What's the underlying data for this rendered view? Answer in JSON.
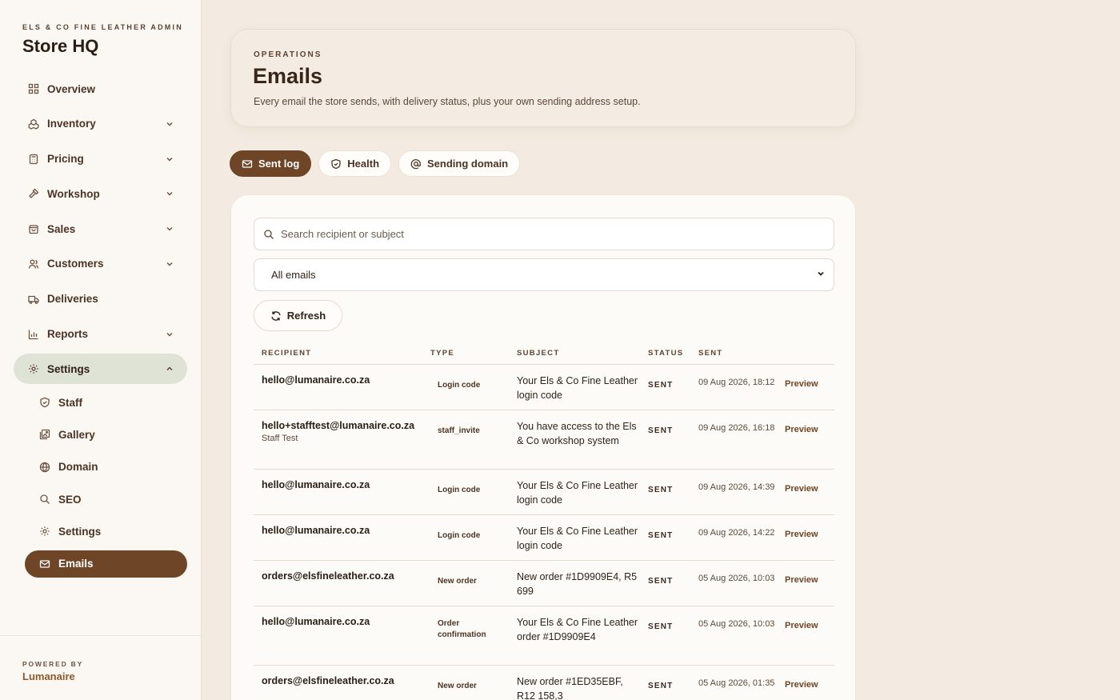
{
  "brand": {
    "eyebrow": "ELS & CO FINE LEATHER ADMIN",
    "title": "Store HQ"
  },
  "nav": {
    "items": [
      {
        "label": "Overview",
        "icon": "grid-icon"
      },
      {
        "label": "Inventory",
        "icon": "boxes-icon"
      },
      {
        "label": "Pricing",
        "icon": "calculator-icon"
      },
      {
        "label": "Workshop",
        "icon": "hammer-icon"
      },
      {
        "label": "Sales",
        "icon": "bag-icon"
      },
      {
        "label": "Customers",
        "icon": "users-icon"
      },
      {
        "label": "Deliveries",
        "icon": "truck-icon"
      },
      {
        "label": "Reports",
        "icon": "bar-chart-icon"
      },
      {
        "label": "Settings",
        "icon": "gear-icon"
      }
    ],
    "settings_sub": [
      {
        "label": "Staff",
        "icon": "shield-icon"
      },
      {
        "label": "Gallery",
        "icon": "images-icon"
      },
      {
        "label": "Domain",
        "icon": "globe-icon"
      },
      {
        "label": "SEO",
        "icon": "search-icon"
      },
      {
        "label": "Settings",
        "icon": "gear-icon"
      },
      {
        "label": "Emails",
        "icon": "mail-icon"
      }
    ]
  },
  "footer": {
    "powered": "POWERED BY",
    "brand": "Lumanaire"
  },
  "header": {
    "eyebrow": "OPERATIONS",
    "title": "Emails",
    "description": "Every email the store sends, with delivery status, plus your own sending address setup."
  },
  "tabs": [
    {
      "label": "Sent log",
      "icon": "mail-icon"
    },
    {
      "label": "Health",
      "icon": "shield-icon"
    },
    {
      "label": "Sending domain",
      "icon": "at-icon"
    }
  ],
  "filters": {
    "search_placeholder": "Search recipient or subject",
    "select_value": "All emails",
    "refresh_label": "Refresh"
  },
  "table": {
    "headers": [
      "RECIPIENT",
      "TYPE",
      "SUBJECT",
      "STATUS",
      "SENT"
    ],
    "action_label": "Preview",
    "rows": [
      {
        "email": "hello@lumanaire.co.za",
        "name": "",
        "type": "Login code",
        "subject": "Your Els & Co Fine Leather login code",
        "status": "SENT",
        "sent": "09 Aug 2026, 18:12"
      },
      {
        "email": "hello+stafftest@lumanaire.co.za",
        "name": "Staff Test",
        "type": "staff_invite",
        "subject": "You have access to the Els & Co workshop system",
        "status": "SENT",
        "sent": "09 Aug 2026, 16:18"
      },
      {
        "email": "hello@lumanaire.co.za",
        "name": "",
        "type": "Login code",
        "subject": "Your Els & Co Fine Leather login code",
        "status": "SENT",
        "sent": "09 Aug 2026, 14:39"
      },
      {
        "email": "hello@lumanaire.co.za",
        "name": "",
        "type": "Login code",
        "subject": "Your Els & Co Fine Leather login code",
        "status": "SENT",
        "sent": "09 Aug 2026, 14:22"
      },
      {
        "email": "orders@elsfineleather.co.za",
        "name": "",
        "type": "New order",
        "subject": "New order #1D9909E4, R5 699",
        "status": "SENT",
        "sent": "05 Aug 2026, 10:03"
      },
      {
        "email": "hello@lumanaire.co.za",
        "name": "",
        "type": "Order confirmation",
        "subject": "Your Els & Co Fine Leather order #1D9909E4",
        "status": "SENT",
        "sent": "05 Aug 2026, 10:03"
      },
      {
        "email": "orders@elsfineleather.co.za",
        "name": "",
        "type": "New order",
        "subject": "New order #1ED35EBF, R12 158,3",
        "status": "SENT",
        "sent": "05 Aug 2026, 01:35"
      }
    ]
  },
  "colors": {
    "accent": "#6e4526",
    "active_group_bg": "#dfe3d6",
    "page_bg": "#f3ebe1",
    "sidebar_bg": "#fbf8f3"
  }
}
